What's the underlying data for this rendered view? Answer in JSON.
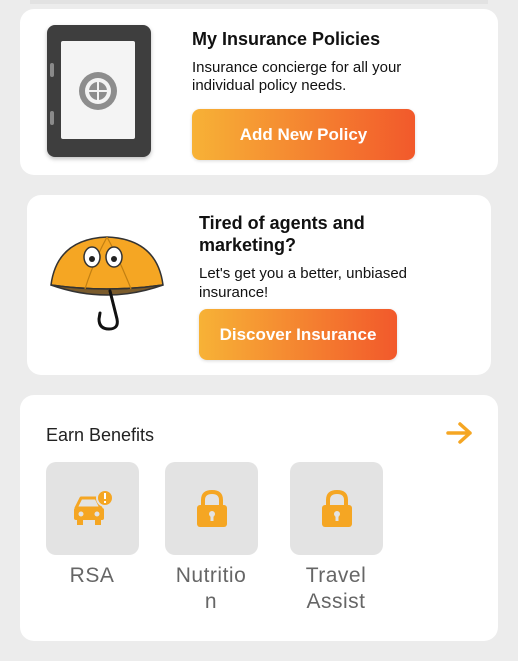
{
  "insurance_card": {
    "title": "My Insurance Policies",
    "description_line1": "Insurance concierge for all your",
    "description_line2": "individual policy needs.",
    "button_label": "Add New Policy"
  },
  "marketing_card": {
    "title_line1": "Tired of agents and",
    "title_line2": "marketing?",
    "description_line1": "Let's get you a better, unbiased",
    "description_line2": "insurance!",
    "button_label": "Discover Insurance"
  },
  "benefits": {
    "title": "Earn Benefits",
    "items": [
      {
        "label_line1": "RSA",
        "label_line2": "",
        "icon": "car-alert-icon"
      },
      {
        "label_line1": "Nutritio",
        "label_line2": "n",
        "icon": "lock-icon"
      },
      {
        "label_line1": "Travel",
        "label_line2": "Assist",
        "icon": "lock-icon"
      }
    ]
  },
  "colors": {
    "accent_start": "#f7b236",
    "accent_end": "#f2592b",
    "icon_orange": "#f5a623",
    "background": "#ececec"
  }
}
